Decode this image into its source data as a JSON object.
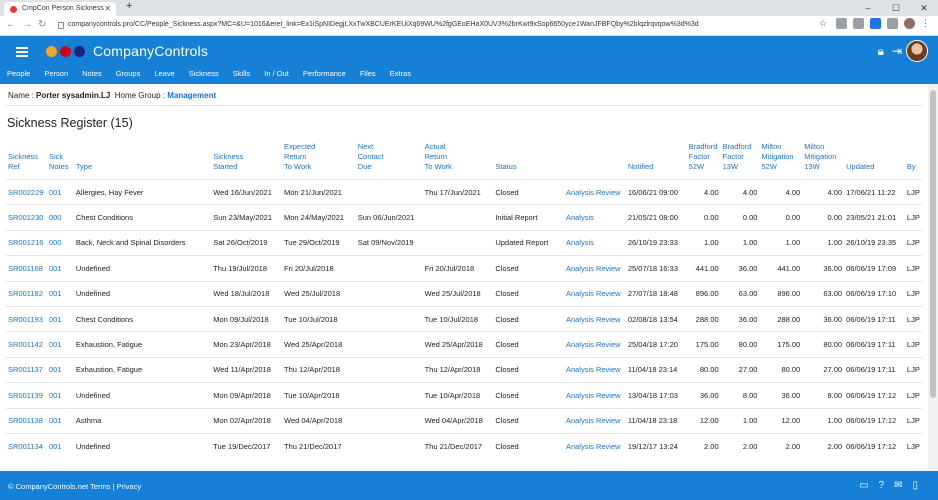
{
  "browser": {
    "tab_title": "CmpCon Person Sickness",
    "url": "companycontrols.pro/CC/People_Sickness.aspx?MC=&U=1016&eret_link=Ex1iSpNIDegjLXxTwXBCUErKEUiXq69WU%2fgGEoEHaX0UV3%2brKwt9xSop6650yce1WanJFBFQby%2blqzlrqvqow%3d%3d"
  },
  "header": {
    "brand": "CompanyControls",
    "logo_colors": [
      "#f5a623",
      "#d0021b",
      "#1a237e"
    ],
    "menu": [
      "People",
      "Person",
      "Notes",
      "Groups",
      "Leave",
      "Sickness",
      "Skills",
      "In / Out",
      "Performance",
      "Files",
      "Extras"
    ]
  },
  "owner": {
    "name_label": "Name :",
    "name": "Porter sysadmin.LJ",
    "group_label": "Home Group :",
    "group": "Management"
  },
  "page_title": "Sickness Register (15)",
  "table": {
    "columns": [
      [
        "Sickness",
        "Ref"
      ],
      [
        "Sick",
        "Notes"
      ],
      [
        "Type"
      ],
      [
        "Sickness",
        "Started"
      ],
      [
        "Expected",
        "Return",
        "To Work"
      ],
      [
        "Next",
        "Contact",
        "Due"
      ],
      [
        "Actual",
        "Return",
        "To Work"
      ],
      [
        "Status"
      ],
      [
        ""
      ],
      [
        "Notified"
      ],
      [
        "Bradford",
        "Factor",
        "52W"
      ],
      [
        "Bradford",
        "Factor",
        "13W"
      ],
      [
        "Milton",
        "Mitigation",
        "52W"
      ],
      [
        "Milton",
        "Mitigation",
        "13W"
      ],
      [
        "Updated"
      ],
      [
        "By"
      ]
    ],
    "rows": [
      [
        "SR002229",
        "001",
        "Allergies, Hay Fever",
        "Wed 16/Jun/2021",
        "Mon 21/Jun/2021",
        "",
        "Thu 17/Jun/2021",
        "Closed",
        "Analysis Review",
        "16/06/21 09:00",
        "4.00",
        "4.00",
        "4.00",
        "4.00",
        "17/06/21 11:22",
        "LJP"
      ],
      [
        "SR001230",
        "000",
        "Chest Conditions",
        "Sun 23/May/2021",
        "Mon 24/May/2021",
        "Sun 06/Jun/2021",
        "",
        "Initial Report",
        "Analysis",
        "21/05/21 08:00",
        "0.00",
        "0.00",
        "0.00",
        "0.00",
        "23/05/21 21:01",
        "LJP"
      ],
      [
        "SR001216",
        "000",
        "Back, Neck and Spinal Disorders",
        "Sat 26/Oct/2019",
        "Tue 29/Oct/2019",
        "Sat 09/Nov/2019",
        "",
        "Updated Report",
        "Analysis",
        "26/10/19 23:33",
        "1.00",
        "1.00",
        "1.00",
        "1.00",
        "26/10/19 23:35",
        "LJP"
      ],
      [
        "SR001168",
        "001",
        "Undefined",
        "Thu 19/Jul/2018",
        "Fri 20/Jul/2018",
        "",
        "Fri 20/Jul/2018",
        "Closed",
        "Analysis Review",
        "25/07/18 16:33",
        "441.00",
        "36.00",
        "441.00",
        "36.00",
        "06/06/19 17:09",
        "LJP"
      ],
      [
        "SR001182",
        "001",
        "Undefined",
        "Wed 18/Jul/2018",
        "Wed 25/Jul/2018",
        "",
        "Wed 25/Jul/2018",
        "Closed",
        "Analysis Review",
        "27/07/18 18:48",
        "896.00",
        "63.00",
        "896.00",
        "63.00",
        "06/06/19 17:10",
        "LJP"
      ],
      [
        "SR001193",
        "001",
        "Chest Conditions",
        "Mon 09/Jul/2018",
        "Tue 10/Jul/2018",
        "",
        "Tue 10/Jul/2018",
        "Closed",
        "Analysis Review",
        "02/08/18 13:54",
        "288.00",
        "36.00",
        "288.00",
        "36.00",
        "06/06/19 17:11",
        "LJP"
      ],
      [
        "SR001142",
        "001",
        "Exhaustion, Fatigue",
        "Mon 23/Apr/2018",
        "Wed 25/Apr/2018",
        "",
        "Wed 25/Apr/2018",
        "Closed",
        "Analysis Review",
        "25/04/18 17:20",
        "175.00",
        "80.00",
        "175.00",
        "80.00",
        "06/06/19 17:11",
        "LJP"
      ],
      [
        "SR001137",
        "001",
        "Exhaustion, Fatigue",
        "Wed 11/Apr/2018",
        "Thu 12/Apr/2018",
        "",
        "Thu 12/Apr/2018",
        "Closed",
        "Analysis Review",
        "11/04/18 23:14",
        "80.00",
        "27.00",
        "80.00",
        "27.00",
        "06/06/19 17:11",
        "LJP"
      ],
      [
        "SR001139",
        "001",
        "Undefined",
        "Mon 09/Apr/2018",
        "Tue 10/Apr/2018",
        "",
        "Tue 10/Apr/2018",
        "Closed",
        "Analysis Review",
        "13/04/18 17:03",
        "36.00",
        "8.00",
        "36.00",
        "8.00",
        "06/06/19 17:12",
        "LJP"
      ],
      [
        "SR001138",
        "001",
        "Asthma",
        "Mon 02/Apr/2018",
        "Wed 04/Apr/2018",
        "",
        "Wed 04/Apr/2018",
        "Closed",
        "Analysis Review",
        "11/04/18 23:18",
        "12.00",
        "1.00",
        "12.00",
        "1.00",
        "06/06/19 17:12",
        "LJP"
      ],
      [
        "SR001134",
        "001",
        "Undefined",
        "Tue 19/Dec/2017",
        "Thu 21/Dec/2017",
        "",
        "Thu 21/Dec/2017",
        "Closed",
        "Analysis Review",
        "19/12/17 13:24",
        "2.00",
        "2.00",
        "2.00",
        "2.00",
        "06/06/19 17:12",
        "LJP"
      ]
    ]
  },
  "footer": {
    "text": "© CompanyControls.net Terms | Privacy"
  }
}
